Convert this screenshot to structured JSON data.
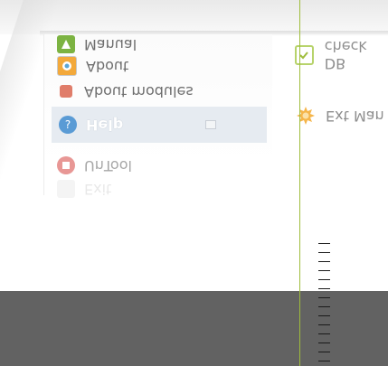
{
  "menu": {
    "items": [
      {
        "label": "Manual",
        "icon": "manual-icon"
      },
      {
        "label": "About",
        "icon": "about-icon"
      },
      {
        "label": "About modules",
        "icon": "modules-icon"
      },
      {
        "label": "Help",
        "icon": "help-icon"
      },
      {
        "label": "UnTool",
        "icon": "untool-icon"
      },
      {
        "label": "Exit",
        "icon": "exit-icon"
      }
    ]
  },
  "right": {
    "items": [
      {
        "label": "DB check",
        "icon": "db-check-icon"
      },
      {
        "label": "Ext Man",
        "icon": "ext-man-icon"
      }
    ]
  },
  "colors": {
    "guide_line": "#9fbd3c",
    "bottom_bar": "#626262",
    "highlight": "#e6ebf1"
  }
}
